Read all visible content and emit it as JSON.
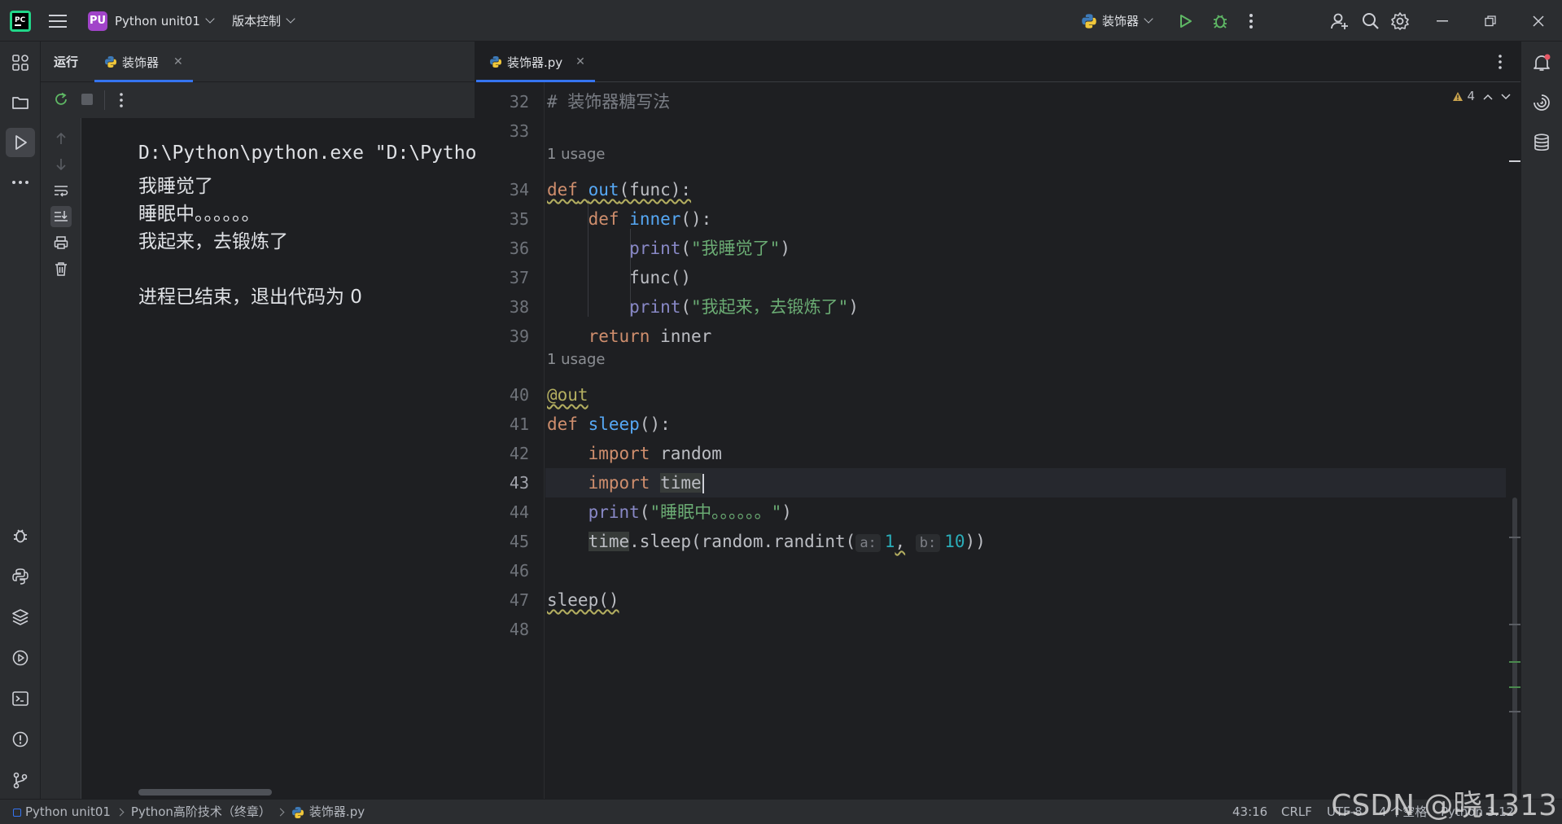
{
  "titlebar": {
    "project_badge": "PU",
    "project_name": "Python unit01",
    "vcs_label": "版本控制",
    "run_config": "装饰器"
  },
  "run_panel": {
    "title": "运行",
    "tab_label": "装饰器",
    "console": [
      "D:\\Python\\python.exe \"D:\\Python",
      "我睡觉了",
      "睡眠中。。。。。。",
      "我起来，去锻炼了",
      "进程已结束，退出代码为 0"
    ]
  },
  "editor": {
    "tab_label": "装饰器.py",
    "warnings_count": "4",
    "line_numbers": [
      "32",
      "33",
      "34",
      "35",
      "36",
      "37",
      "38",
      "39",
      "40",
      "41",
      "42",
      "43",
      "44",
      "45",
      "46",
      "47",
      "48"
    ],
    "current_line": "43",
    "usage_hint": "1 usage",
    "code": {
      "l32": "# 装饰器糖写法",
      "l34_kw": "def",
      "l34_fn": "out",
      "l34_rest": "(func):",
      "l35_kw": "def",
      "l35_fn": "inner",
      "l35_rest": "():",
      "l36_builtin": "print",
      "l36_open": "(",
      "l36_str": "\"我睡觉了\"",
      "l36_close": ")",
      "l37": "func()",
      "l38_builtin": "print",
      "l38_open": "(",
      "l38_str": "\"我起来，去锻炼了\"",
      "l38_close": ")",
      "l39_kw": "return",
      "l39_rest": " inner",
      "l40": "@out",
      "l41_kw": "def",
      "l41_fn": "sleep",
      "l41_rest": "():",
      "l42_kw": "import",
      "l42_rest": " random",
      "l43_kw": "import",
      "l43_rest": "time",
      "l44_builtin": "print",
      "l44_open": "(",
      "l44_str": "\"睡眠中。。。。。。\"",
      "l44_close": ")",
      "l45_a": "time",
      "l45_b": ".sleep(random.randint(",
      "l45_hint_a": "a:",
      "l45_num1": "1",
      "l45_comma": ",",
      "l45_hint_b": "b:",
      "l45_num2": "10",
      "l45_end": "))",
      "l47": "sleep()"
    }
  },
  "statusbar": {
    "crumbs": [
      "Python unit01",
      "Python高阶技术（终章）",
      "装饰器.py"
    ],
    "position": "43:16",
    "line_sep": "CRLF",
    "encoding": "UTF-8",
    "indent": "4 个空格",
    "interpreter": "Python 3.12"
  },
  "watermark": "CSDN @晓1313",
  "colors": {
    "accent": "#3574f0",
    "run_green": "#5fb865",
    "project_badge": "#a144c9",
    "notification_dot": "#e55765"
  }
}
